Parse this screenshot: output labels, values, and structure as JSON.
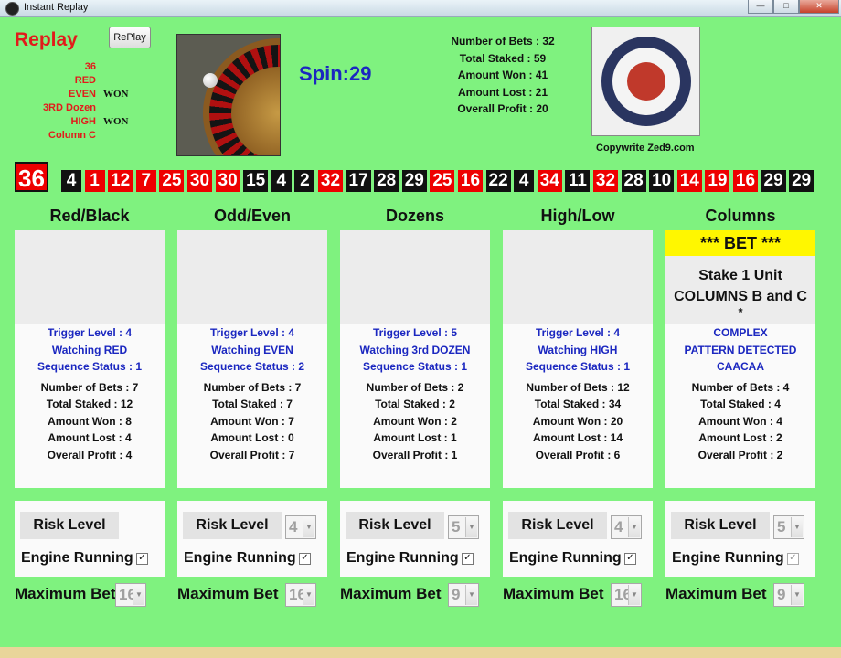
{
  "window": {
    "title": "Instant Replay",
    "controls": [
      "—",
      "□",
      "✕"
    ]
  },
  "replay": {
    "title": "Replay",
    "button_label": "RePlay",
    "results": [
      {
        "label": "36",
        "outcome": ""
      },
      {
        "label": "RED",
        "outcome": ""
      },
      {
        "label": "EVEN",
        "outcome": "WON"
      },
      {
        "label": "3RD Dozen",
        "outcome": ""
      },
      {
        "label": "HIGH",
        "outcome": "WON"
      },
      {
        "label": "Column C",
        "outcome": ""
      }
    ]
  },
  "spin": "Spin:29",
  "summary": [
    "Number of Bets : 32",
    "Total Staked : 59",
    "Amount Won : 41",
    "Amount Lost : 21",
    "Overall Profit : 20"
  ],
  "copyright": "Copywrite Zed9.com",
  "history": [
    {
      "n": "36",
      "c": "red"
    },
    {
      "n": "4",
      "c": "black"
    },
    {
      "n": "1",
      "c": "red"
    },
    {
      "n": "12",
      "c": "red"
    },
    {
      "n": "7",
      "c": "red"
    },
    {
      "n": "25",
      "c": "red"
    },
    {
      "n": "30",
      "c": "red"
    },
    {
      "n": "30",
      "c": "red"
    },
    {
      "n": "15",
      "c": "black"
    },
    {
      "n": "4",
      "c": "black"
    },
    {
      "n": "2",
      "c": "black"
    },
    {
      "n": "32",
      "c": "red"
    },
    {
      "n": "17",
      "c": "black"
    },
    {
      "n": "28",
      "c": "black"
    },
    {
      "n": "29",
      "c": "black"
    },
    {
      "n": "25",
      "c": "red"
    },
    {
      "n": "16",
      "c": "red"
    },
    {
      "n": "22",
      "c": "black"
    },
    {
      "n": "4",
      "c": "black"
    },
    {
      "n": "34",
      "c": "red"
    },
    {
      "n": "11",
      "c": "black"
    },
    {
      "n": "32",
      "c": "red"
    },
    {
      "n": "28",
      "c": "black"
    },
    {
      "n": "10",
      "c": "black"
    },
    {
      "n": "14",
      "c": "red"
    },
    {
      "n": "19",
      "c": "red"
    },
    {
      "n": "16",
      "c": "red"
    },
    {
      "n": "29",
      "c": "black"
    },
    {
      "n": "29",
      "c": "black"
    }
  ],
  "panels": [
    {
      "title": "Red/Black",
      "info": [
        "Trigger Level : 4",
        "Watching RED",
        "Sequence Status : 1"
      ],
      "stats": [
        "Number of Bets : 7",
        "Total Staked : 12",
        "Amount Won : 8",
        "Amount Lost : 4",
        "Overall Profit : 4"
      ],
      "risk_label": "Risk Level",
      "risk_value": "",
      "engine_label": "Engine Running",
      "engine_checked": true,
      "maxbet_label": "Maximum Bet",
      "maxbet_value": "16"
    },
    {
      "title": "Odd/Even",
      "info": [
        "Trigger Level : 4",
        "Watching EVEN",
        "Sequence Status : 2"
      ],
      "stats": [
        "Number of Bets : 7",
        "Total Staked : 7",
        "Amount Won : 7",
        "Amount Lost : 0",
        "Overall Profit : 7"
      ],
      "risk_label": "Risk Level",
      "risk_value": "4",
      "engine_label": "Engine Running",
      "engine_checked": true,
      "maxbet_label": "Maximum Bet",
      "maxbet_value": "16"
    },
    {
      "title": "Dozens",
      "info": [
        "Trigger Level : 5",
        "Watching 3rd DOZEN",
        "Sequence Status : 1"
      ],
      "stats": [
        "Number of Bets : 2",
        "Total Staked : 2",
        "Amount Won : 2",
        "Amount Lost : 1",
        "Overall Profit : 1"
      ],
      "risk_label": "Risk Level",
      "risk_value": "5",
      "engine_label": "Engine Running",
      "engine_checked": true,
      "maxbet_label": "Maximum Bet",
      "maxbet_value": "9"
    },
    {
      "title": "High/Low",
      "info": [
        "Trigger Level : 4",
        "Watching HIGH",
        "Sequence Status : 1"
      ],
      "stats": [
        "Number of Bets : 12",
        "Total Staked : 34",
        "Amount Won : 20",
        "Amount Lost : 14",
        "Overall Profit : 6"
      ],
      "risk_label": "Risk Level",
      "risk_value": "4",
      "engine_label": "Engine Running",
      "engine_checked": true,
      "maxbet_label": "Maximum Bet",
      "maxbet_value": "16"
    },
    {
      "title": "Columns",
      "bet_banner": "*** BET ***",
      "stake_lines": [
        "Stake 1 Unit",
        "COLUMNS B and C"
      ],
      "stake_star": "*",
      "info": [
        "COMPLEX",
        "PATTERN DETECTED",
        "CAACAA"
      ],
      "stats": [
        "Number of Bets : 4",
        "Total Staked : 4",
        "Amount Won : 4",
        "Amount Lost : 2",
        "Overall Profit : 2"
      ],
      "risk_label": "Risk Level",
      "risk_value": "5",
      "engine_label": "Engine Running",
      "engine_checked": true,
      "engine_disabled": true,
      "maxbet_label": "Maximum Bet",
      "maxbet_value": "9"
    }
  ],
  "colors": {
    "background": "#7ff27f",
    "accent_red": "#e21b1b",
    "accent_blue": "#1b27c0",
    "bet_banner": "#fff700"
  },
  "icons": [
    "roulette-wheel-image",
    "target-icon",
    "app-icon"
  ]
}
